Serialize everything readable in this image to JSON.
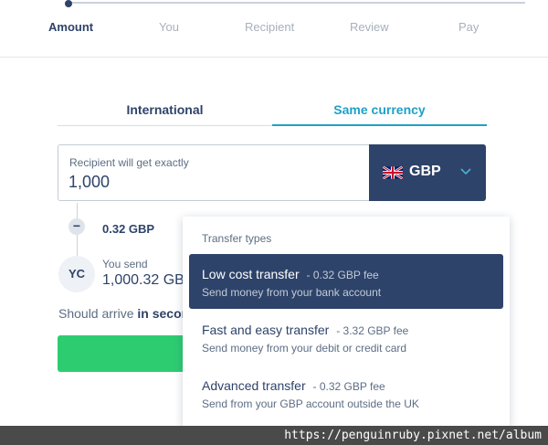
{
  "stepper": {
    "steps": [
      "Amount",
      "You",
      "Recipient",
      "Review",
      "Pay"
    ],
    "active_index": 0
  },
  "tabs": [
    {
      "label": "International",
      "active": false
    },
    {
      "label": "Same currency",
      "active": true
    }
  ],
  "amount": {
    "label": "Recipient will get exactly",
    "value": "1,000",
    "currency": "GBP",
    "currency_flag": "uk-flag-icon"
  },
  "fee": {
    "value": "0.32 GBP"
  },
  "sender": {
    "initials": "YC",
    "label": "You send",
    "value": "1,000.32 GB"
  },
  "arrival": {
    "prefix": "Should arrive",
    "emphasis": "in secon"
  },
  "dropdown": {
    "title": "Transfer types",
    "options": [
      {
        "title": "Low cost transfer",
        "fee": "- 0.32 GBP fee",
        "description": "Send money from your bank account",
        "selected": true
      },
      {
        "title": "Fast and easy transfer",
        "fee": "- 3.32 GBP fee",
        "description": "Send money from your debit or credit card",
        "selected": false
      },
      {
        "title": "Advanced transfer",
        "fee": "- 0.32 GBP fee",
        "description": "Send from your GBP account outside the UK",
        "selected": false
      }
    ]
  },
  "watermark": {
    "text": "https://penguinruby.pixnet.net/album"
  },
  "colors": {
    "navy": "#2e4369",
    "accent": "#1fa0c6",
    "button_green": "#2ecc71"
  }
}
